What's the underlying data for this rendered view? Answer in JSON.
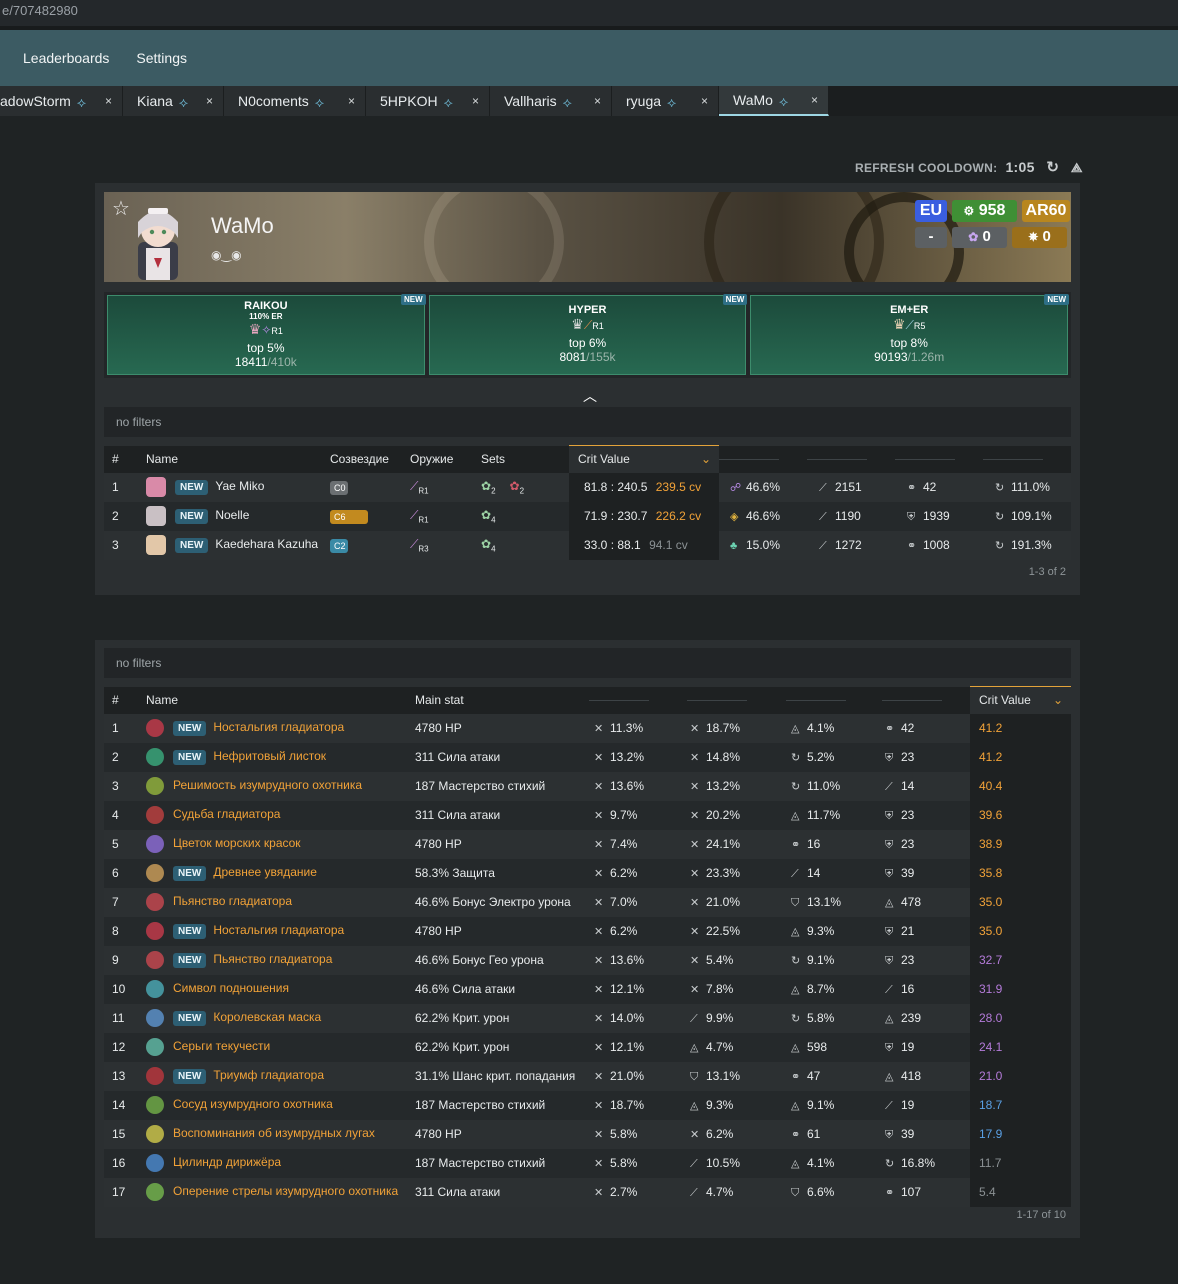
{
  "url": "e/707482980",
  "nav": {
    "leaderboards": "Leaderboards",
    "settings": "Settings"
  },
  "tabs": [
    {
      "label": "adowStorm",
      "close": "×"
    },
    {
      "label": "Kiana",
      "close": "×"
    },
    {
      "label": "N0coments",
      "close": "×"
    },
    {
      "label": "5HPKOH",
      "close": "×"
    },
    {
      "label": "Vallharis",
      "close": "×"
    },
    {
      "label": "ryuga",
      "close": "×"
    },
    {
      "label": "WaMo",
      "close": "×",
      "active": true
    }
  ],
  "refresh": {
    "label": "REFRESH COOLDOWN:",
    "time": "1:05"
  },
  "profile": {
    "name": "WaMo",
    "signature": "◉‿◉",
    "region": "EU",
    "achievements": "958",
    "ar": "AR60",
    "abyss": "-",
    "theater": "0",
    "other": "0"
  },
  "builds": [
    {
      "name": "RAIKOU",
      "sub": "110% ER",
      "refine": "R1",
      "top": "top 5%",
      "rank": "18411",
      "total": "/410k",
      "new": "NEW"
    },
    {
      "name": "HYPER",
      "sub": "",
      "refine": "R1",
      "top": "top 6%",
      "rank": "8081",
      "total": "/155k",
      "new": "NEW"
    },
    {
      "name": "EM+ER",
      "sub": "",
      "refine": "R5",
      "top": "top 8%",
      "rank": "90193",
      "total": "/1.26m",
      "new": "NEW"
    }
  ],
  "filters1": "no filters",
  "chars_table": {
    "headers": {
      "num": "#",
      "name": "Name",
      "cons": "Созвездие",
      "weapon": "Оружие",
      "sets": "Sets",
      "cv": "Crit Value"
    },
    "rows": [
      {
        "n": "1",
        "new": "NEW",
        "name": "Yae Miko",
        "cons": "C0",
        "cons_color": "#6b6f72",
        "refine": "R1",
        "set1": "2",
        "set2": "2",
        "ratio": "81.8 : 240.5",
        "cv": "239.5 cv",
        "s1": "46.6%",
        "s2": "2151",
        "s3": "42",
        "s4": "111.0%",
        "icon_color": "#d98aa8"
      },
      {
        "n": "2",
        "new": "NEW",
        "name": "Noelle",
        "cons": "C6",
        "cons_color": "#c28a1f",
        "refine": "R1",
        "set1": "4",
        "set2": "",
        "ratio": "71.9 : 230.7",
        "cv": "226.2 cv",
        "s1": "46.6%",
        "s2": "1190",
        "s3": "1939",
        "s4": "109.1%",
        "icon_color": "#c9c0c4"
      },
      {
        "n": "3",
        "new": "NEW",
        "name": "Kaedehara Kazuha",
        "cons": "C2",
        "cons_color": "#3a8aa6",
        "refine": "R3",
        "set1": "4",
        "set2": "",
        "ratio": "33.0 : 88.1",
        "cv": "94.1 cv",
        "s1": "15.0%",
        "s2": "1272",
        "s3": "1008",
        "s4": "191.3%",
        "icon_color": "#e2c7a8"
      }
    ],
    "footer": "1-3 of 2"
  },
  "filters2": "no filters",
  "artifacts_table": {
    "headers": {
      "num": "#",
      "name": "Name",
      "main": "Main stat",
      "cv": "Crit Value"
    },
    "rows": [
      {
        "n": "1",
        "new": "NEW",
        "name": "Ностальгия гладиатора",
        "main": "4780 HP",
        "a": "11.3%",
        "b": "18.7%",
        "c": "4.1%",
        "d": "42",
        "cv": "41.2",
        "cvc": "orange",
        "ic": "#c0394a"
      },
      {
        "n": "2",
        "new": "NEW",
        "name": "Нефритовый листок",
        "main": "311 Сила атаки",
        "a": "13.2%",
        "b": "14.8%",
        "c": "5.2%",
        "d": "23",
        "cv": "41.2",
        "cvc": "orange",
        "ic": "#3aa57a"
      },
      {
        "n": "3",
        "new": "",
        "name": "Решимость изумрудного охотника",
        "main": "187 Мастерство стихий",
        "a": "13.6%",
        "b": "13.2%",
        "c": "11.0%",
        "d": "14",
        "cv": "40.4",
        "cvc": "orange",
        "ic": "#8fae3c"
      },
      {
        "n": "4",
        "new": "",
        "name": "Судьба гладиатора",
        "main": "311 Сила атаки",
        "a": "9.7%",
        "b": "20.2%",
        "c": "11.7%",
        "d": "23",
        "cv": "39.6",
        "cvc": "orange",
        "ic": "#b84040"
      },
      {
        "n": "5",
        "new": "",
        "name": "Цветок морских красок",
        "main": "4780 HP",
        "a": "7.4%",
        "b": "24.1%",
        "c": "16",
        "d": "23",
        "cv": "38.9",
        "cvc": "orange",
        "ic": "#8a6ad1"
      },
      {
        "n": "6",
        "new": "NEW",
        "name": "Древнее увядание",
        "main": "58.3% Защита",
        "a": "6.2%",
        "b": "23.3%",
        "c": "14",
        "d": "39",
        "cv": "35.8",
        "cvc": "orange",
        "ic": "#c79a58"
      },
      {
        "n": "7",
        "new": "",
        "name": "Пьянство гладиатора",
        "main": "46.6% Бонус Электро урона",
        "a": "7.0%",
        "b": "21.0%",
        "c": "13.1%",
        "d": "478",
        "cv": "35.0",
        "cvc": "orange",
        "ic": "#c2464f"
      },
      {
        "n": "8",
        "new": "NEW",
        "name": "Ностальгия гладиатора",
        "main": "4780 HP",
        "a": "6.2%",
        "b": "22.5%",
        "c": "9.3%",
        "d": "21",
        "cv": "35.0",
        "cvc": "orange",
        "ic": "#c0394a"
      },
      {
        "n": "9",
        "new": "NEW",
        "name": "Пьянство гладиатора",
        "main": "46.6% Бонус Гео урона",
        "a": "13.6%",
        "b": "5.4%",
        "c": "9.1%",
        "d": "23",
        "cv": "32.7",
        "cvc": "purple",
        "ic": "#c2464f"
      },
      {
        "n": "10",
        "new": "",
        "name": "Символ подношения",
        "main": "46.6% Сила атаки",
        "a": "12.1%",
        "b": "7.8%",
        "c": "8.7%",
        "d": "16",
        "cv": "31.9",
        "cvc": "purple",
        "ic": "#4aa4b0"
      },
      {
        "n": "11",
        "new": "NEW",
        "name": "Королевская маска",
        "main": "62.2% Крит. урон",
        "a": "14.0%",
        "b": "9.9%",
        "c": "5.8%",
        "d": "239",
        "cv": "28.0",
        "cvc": "purple",
        "ic": "#5a8fc8"
      },
      {
        "n": "12",
        "new": "",
        "name": "Серьги текучести",
        "main": "62.2% Крит. урон",
        "a": "12.1%",
        "b": "4.7%",
        "c": "598",
        "d": "19",
        "cv": "24.1",
        "cvc": "purple",
        "ic": "#5fb6a3"
      },
      {
        "n": "13",
        "new": "NEW",
        "name": "Триумф гладиатора",
        "main": "31.1% Шанс крит. попадания",
        "a": "21.0%",
        "b": "13.1%",
        "c": "47",
        "d": "418",
        "cv": "21.0",
        "cvc": "purple",
        "ic": "#b6363d"
      },
      {
        "n": "14",
        "new": "",
        "name": "Сосуд изумрудного охотника",
        "main": "187 Мастерство стихий",
        "a": "18.7%",
        "b": "9.3%",
        "c": "9.1%",
        "d": "19",
        "cv": "18.7",
        "cvc": "blue",
        "ic": "#6ea847"
      },
      {
        "n": "15",
        "new": "",
        "name": "Воспоминания об изумрудных лугах",
        "main": "4780 HP",
        "a": "5.8%",
        "b": "6.2%",
        "c": "61",
        "d": "39",
        "cv": "17.9",
        "cvc": "blue",
        "ic": "#c9c24a"
      },
      {
        "n": "16",
        "new": "",
        "name": "Цилиндр дирижёра",
        "main": "187 Мастерство стихий",
        "a": "5.8%",
        "b": "10.5%",
        "c": "4.1%",
        "d": "16.8%",
        "cv": "11.7",
        "cvc": "gray",
        "ic": "#4a86c9"
      },
      {
        "n": "17",
        "new": "",
        "name": "Оперение стрелы изумрудного охотника",
        "main": "311 Сила атаки",
        "a": "2.7%",
        "b": "4.7%",
        "c": "6.6%",
        "d": "107",
        "cv": "5.4",
        "cvc": "gray",
        "ic": "#72b04c"
      }
    ],
    "footer": "1-17 of 10"
  }
}
